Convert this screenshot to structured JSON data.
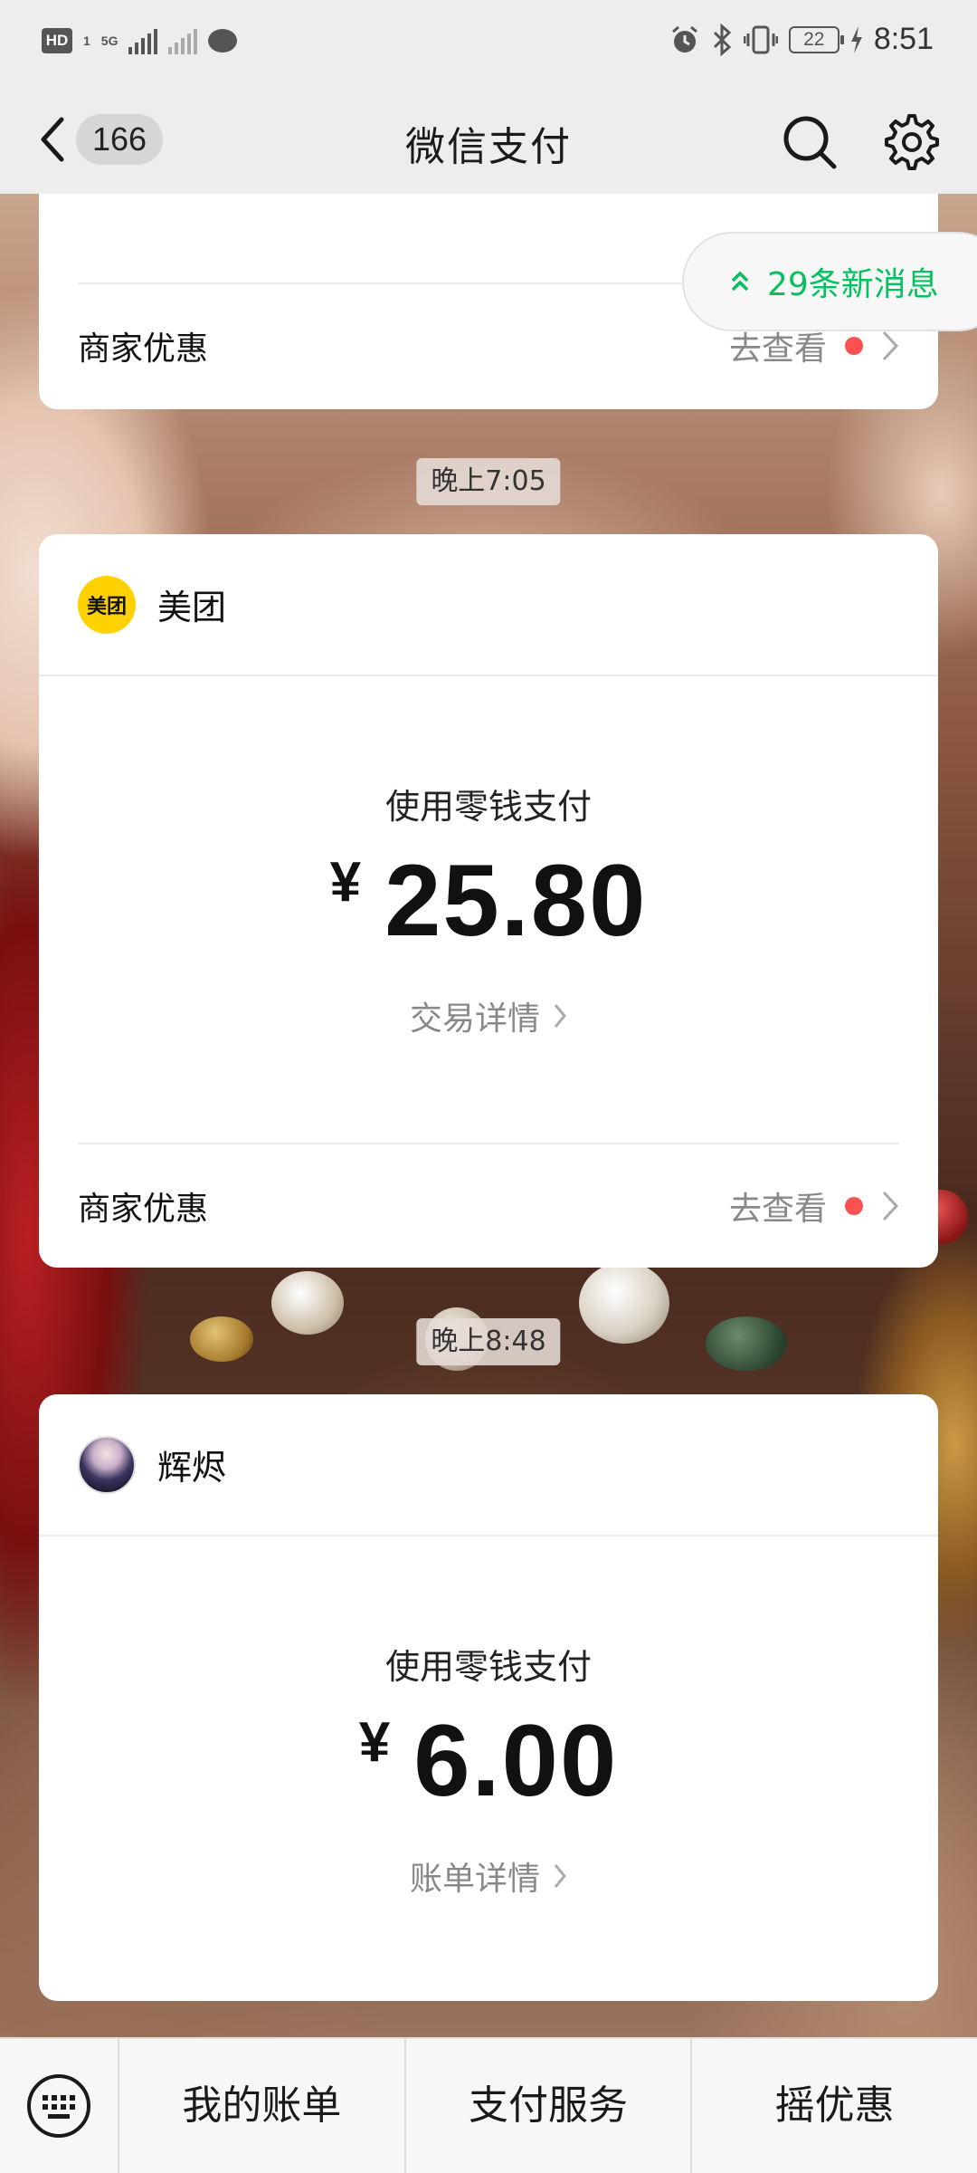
{
  "status_bar": {
    "hd": "HD",
    "hd_sub": "1",
    "network": "5G",
    "time": "8:51",
    "battery": "22"
  },
  "nav": {
    "back_count": "166",
    "title": "微信支付"
  },
  "new_messages": "29条新消息",
  "messages": [
    {
      "row_label": "商家优惠",
      "row_action": "去查看"
    },
    {
      "timestamp": "晚上7:05",
      "merchant": "美团",
      "logo_text": "美团",
      "logo_color": "#ffd100",
      "pay_label": "使用零钱支付",
      "currency": "¥",
      "amount": "25.80",
      "detail_link": "交易详情",
      "row_label": "商家优惠",
      "row_action": "去查看"
    },
    {
      "timestamp": "晚上8:48",
      "merchant": "辉烬",
      "pay_label": "使用零钱支付",
      "currency": "¥",
      "amount": "6.00",
      "detail_link": "账单详情"
    }
  ],
  "bottom_menu": [
    "我的账单",
    "支付服务",
    "摇优惠"
  ],
  "colors": {
    "accent_green": "#07c160",
    "red_dot": "#fa5151"
  },
  "icons": [
    "back-chevron-icon",
    "search-icon",
    "settings-gear-icon",
    "keyboard-icon",
    "chevron-right-icon",
    "double-chevron-up-icon"
  ]
}
